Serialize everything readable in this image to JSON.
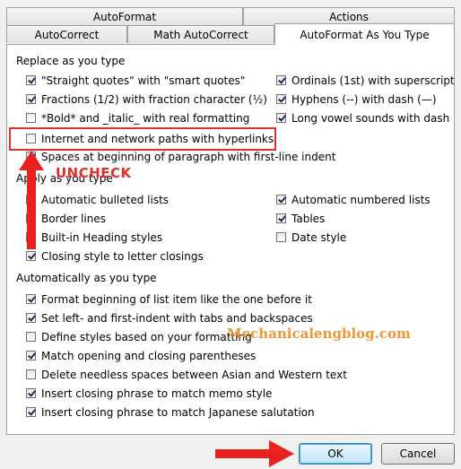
{
  "tabs": {
    "row1": [
      {
        "label": "AutoFormat"
      },
      {
        "label": "Actions"
      }
    ],
    "row2": [
      {
        "label": "AutoCorrect"
      },
      {
        "label": "Math AutoCorrect"
      },
      {
        "label": "AutoFormat As You Type",
        "selected": true
      }
    ]
  },
  "sections": {
    "replace": {
      "title": "Replace as you type",
      "items": [
        {
          "label": "\"Straight quotes\" with \"smart quotes\"",
          "checked": true
        },
        {
          "label": "Ordinals (1st) with superscript",
          "checked": true
        },
        {
          "label": "Fractions (1/2) with fraction character (½)",
          "checked": true
        },
        {
          "label": "Hyphens (--) with dash (—)",
          "checked": true
        },
        {
          "label": "*Bold* and _italic_ with real formatting",
          "checked": false
        },
        {
          "label": "Long vowel sounds with dash",
          "checked": true
        },
        {
          "label": "Internet and network paths with hyperlinks",
          "checked": false
        },
        {
          "label": "Spaces at beginning of paragraph with first-line indent",
          "checked": true
        }
      ]
    },
    "apply": {
      "title": "Apply as you type",
      "items": [
        {
          "label": "Automatic bulleted lists",
          "checked": true
        },
        {
          "label": "Automatic numbered lists",
          "checked": true
        },
        {
          "label": "Border lines",
          "checked": true
        },
        {
          "label": "Tables",
          "checked": true
        },
        {
          "label": "Built-in Heading styles",
          "checked": false
        },
        {
          "label": "Date style",
          "checked": false
        },
        {
          "label": "Closing style to letter closings",
          "checked": true
        }
      ]
    },
    "auto": {
      "title": "Automatically as you type",
      "items": [
        {
          "label": "Format beginning of list item like the one before it",
          "checked": true
        },
        {
          "label": "Set left- and first-indent with tabs and backspaces",
          "checked": true
        },
        {
          "label": "Define styles based on your formatting",
          "checked": false
        },
        {
          "label": "Match opening and closing parentheses",
          "checked": true
        },
        {
          "label": "Delete needless spaces between Asian and Western text",
          "checked": false
        },
        {
          "label": "Insert closing phrase to match memo style",
          "checked": true
        },
        {
          "label": "Insert closing phrase to match Japanese salutation",
          "checked": true
        }
      ]
    }
  },
  "buttons": {
    "ok": "OK",
    "cancel": "Cancel"
  },
  "annotation": {
    "text": "UNCHECK",
    "color": "#e0302a"
  },
  "watermark": {
    "text": "Mechanicalengblog.com",
    "color": "#f08a1e"
  }
}
